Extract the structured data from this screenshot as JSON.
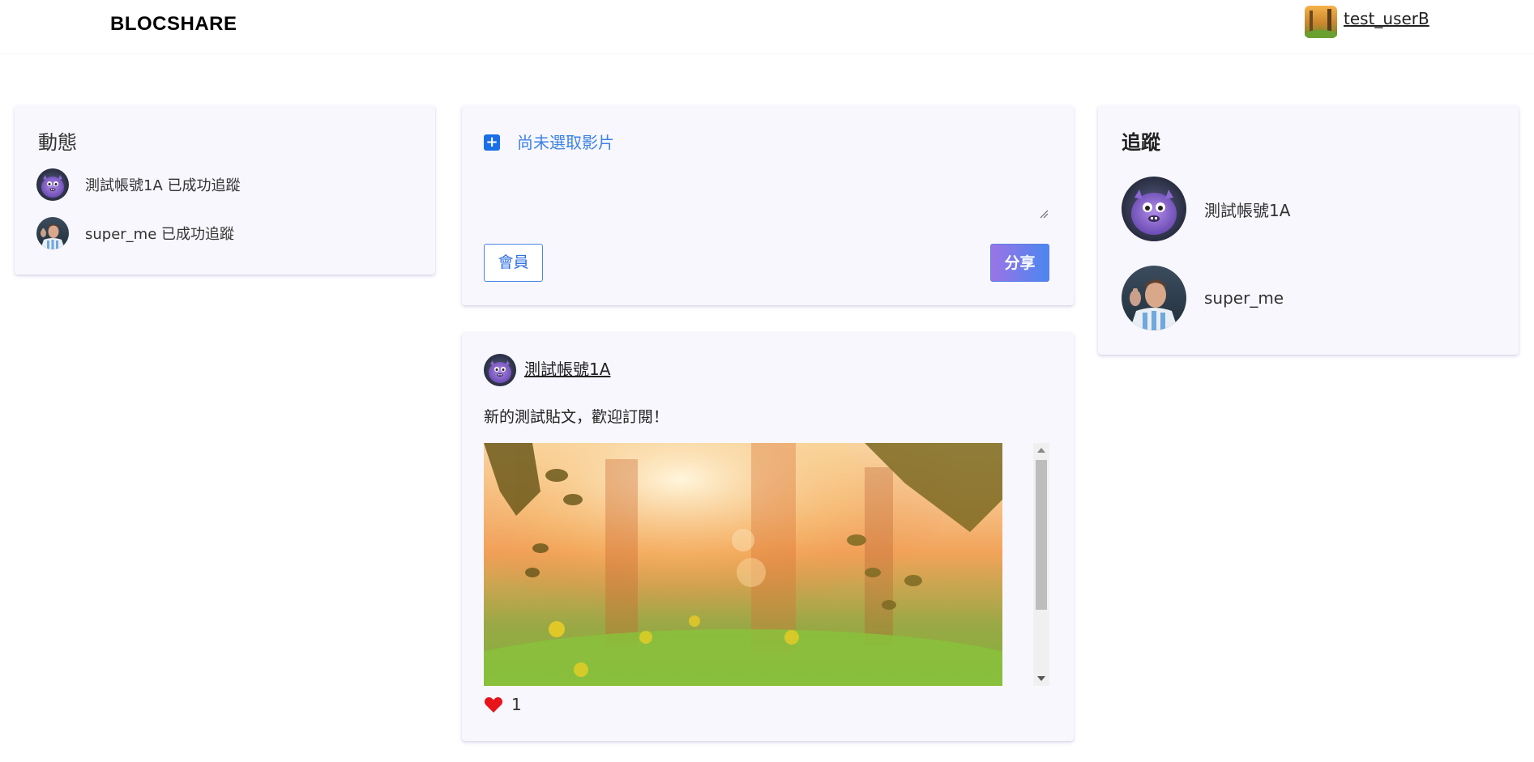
{
  "header": {
    "brand": "BLOCSHARE",
    "username": "test_userB"
  },
  "feed": {
    "title": "動態",
    "items": [
      {
        "text": "測試帳號1A 已成功追蹤",
        "avatar": "purple-monster-avatar"
      },
      {
        "text": "super_me 已成功追蹤",
        "avatar": "soccer-player-avatar"
      }
    ]
  },
  "compose": {
    "upload_label": "尚未選取影片",
    "member_button": "會員",
    "share_button": "分享"
  },
  "post": {
    "author": "測試帳號1A",
    "text": "新的測試貼文，歡迎訂閱！",
    "likes": "1",
    "image_desc": "forest-sunlight-photo"
  },
  "following": {
    "title": "追蹤",
    "items": [
      {
        "name": "測試帳號1A",
        "avatar": "purple-monster-avatar"
      },
      {
        "name": "super_me",
        "avatar": "soccer-player-avatar"
      }
    ]
  },
  "colors": {
    "accent_blue": "#1a6fe6",
    "link_blue": "#3b82e6",
    "card_bg": "#f8f7fd",
    "heart_red": "#e8141c",
    "share_gradient_start": "#9b74e6",
    "share_gradient_end": "#4b86ef"
  }
}
